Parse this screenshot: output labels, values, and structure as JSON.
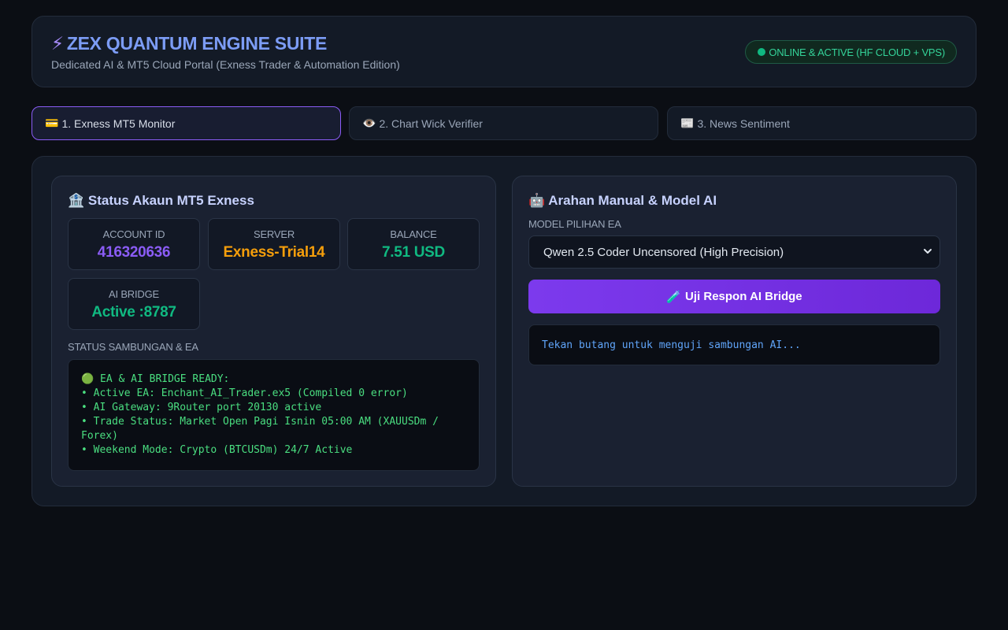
{
  "header": {
    "icon": "bolt-icon",
    "title": "ZEX QUANTUM ENGINE SUITE",
    "subtitle": "Dedicated AI & MT5 Cloud Portal (Exness Trader & Automation Edition)",
    "status": "ONLINE & ACTIVE (HF CLOUD + VPS)"
  },
  "tabs": [
    {
      "icon": "💳",
      "label": "1. Exness MT5 Monitor",
      "active": true
    },
    {
      "icon": "👁️",
      "label": "2. Chart Wick Verifier",
      "active": false
    },
    {
      "icon": "📰",
      "label": "3. News Sentiment",
      "active": false
    }
  ],
  "account": {
    "icon": "🏦",
    "title": "Status Akaun MT5 Exness",
    "stats": [
      {
        "label": "ACCOUNT ID",
        "value": "416320636",
        "color": "#8b5cf6"
      },
      {
        "label": "SERVER",
        "value": "Exness-Trial14",
        "color": "#f59e0b"
      },
      {
        "label": "BALANCE",
        "value": "7.51 USD",
        "color": "#10b981"
      },
      {
        "label": "AI BRIDGE",
        "value": "Active :8787",
        "color": "#10b981"
      }
    ],
    "status_label": "STATUS SAMBUNGAN & EA",
    "log": "🟢 EA & AI BRIDGE READY:\n• Active EA: Enchant_AI_Trader.ex5 (Compiled 0 error)\n• AI Gateway: 9Router port 20130 active\n• Trade Status: Market Open Pagi Isnin 05:00 AM (XAUUSDm / Forex)\n• Weekend Mode: Crypto (BTCUSDm) 24/7 Active"
  },
  "ai": {
    "icon": "🤖",
    "title": "Arahan Manual & Model AI",
    "model_label": "MODEL PILIHAN EA",
    "model_selected": "Qwen 2.5 Coder Uncensored (High Precision)",
    "button_icon": "🧪",
    "button_label": "Uji Respon AI Bridge",
    "response": "Tekan butang untuk menguji sambungan AI..."
  },
  "colors": {
    "accent": "#8b5cf6",
    "success": "#10b981",
    "warning": "#f59e0b",
    "info": "#60a5fa"
  }
}
